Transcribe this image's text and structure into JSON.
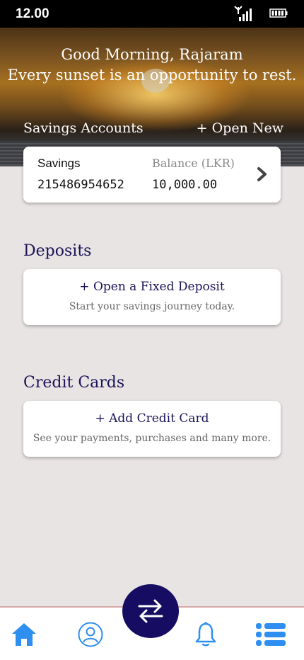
{
  "status": {
    "time": "12.00",
    "icons": [
      "signal-icon",
      "battery-icon"
    ]
  },
  "hero": {
    "greeting": "Good Morning, Rajaram",
    "tagline": "Every sunset is an opportunity to rest.",
    "savings_title": "Savings Accounts",
    "open_new": "+ Open New"
  },
  "savings_card": {
    "account_label": "Savings",
    "account_number": "215486954652",
    "balance_label": "Balance (LKR)",
    "balance": "10,000.00",
    "icon": "chevron-right-icon"
  },
  "deposits": {
    "heading": "Deposits",
    "action": "+ Open a Fixed Deposit",
    "subtitle": "Start your savings journey today."
  },
  "credit_cards": {
    "heading": "Credit Cards",
    "action": "+ Add Credit Card",
    "subtitle": "See your payments, purchases and many more."
  },
  "bottom_nav": {
    "items": [
      "home-icon",
      "profile-icon",
      "transfer-icon",
      "bell-icon",
      "menu-list-icon"
    ]
  },
  "colors": {
    "navy": "#1a1357",
    "transfer_bg": "#160c62",
    "icon_blue": "#2f8ff0",
    "background": "#e9e4e4"
  }
}
